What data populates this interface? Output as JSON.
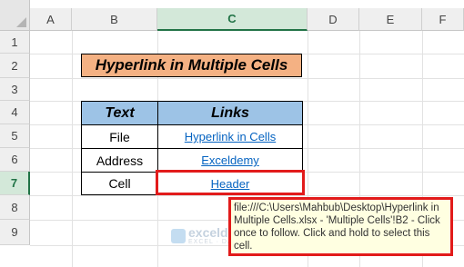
{
  "columns": [
    "A",
    "B",
    "C",
    "D",
    "E",
    "F"
  ],
  "selected_column": "C",
  "rows": [
    "1",
    "2",
    "3",
    "4",
    "5",
    "6",
    "7",
    "8",
    "9"
  ],
  "selected_row": "7",
  "title": "Hyperlink in Multiple Cells",
  "table": {
    "headers": [
      "Text",
      "Links"
    ],
    "rows": [
      {
        "text": "File",
        "link": "Hyperlink in Cells "
      },
      {
        "text": "Address",
        "link": "Exceldemy"
      },
      {
        "text": "Cell",
        "link": "Header"
      }
    ]
  },
  "tooltip": "file:///C:\\Users\\Mahbub\\Desktop\\Hyperlink in Multiple Cells.xlsx - 'Multiple Cells'!B2 - Click once to follow. Click and hold to select this cell.",
  "watermark": {
    "name": "exceldemy",
    "sub": "EXCEL · DATA · BI"
  },
  "colors": {
    "title_fill": "#f4b183",
    "header_fill": "#9dc3e6",
    "link": "#0563c1",
    "highlight": "#e21b1b",
    "selection": "#217346"
  }
}
